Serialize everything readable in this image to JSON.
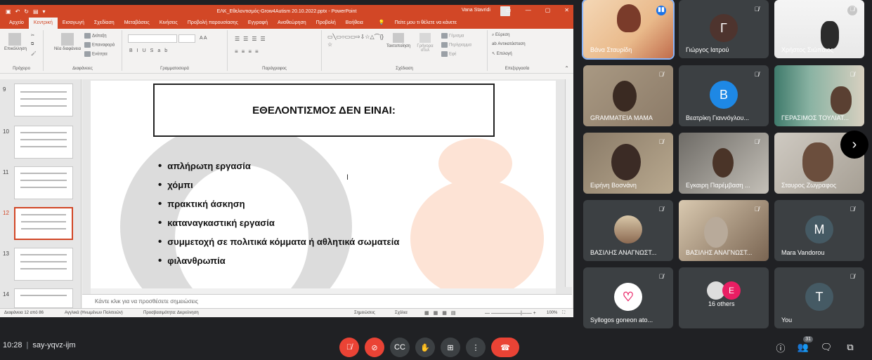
{
  "ppt": {
    "doc_title": "ΕΛΚ_Εθελοντισμός-Grow4Autism 20.10.2022.pptx - PowerPoint",
    "user": "Vana Stavridi",
    "tabs": [
      "Αρχείο",
      "Κεντρική",
      "Εισαγωγή",
      "Σχεδίαση",
      "Μεταβάσεις",
      "Κινήσεις",
      "Προβολή παρουσίασης",
      "Εγγραφή",
      "Αναθεώρηση",
      "Προβολή",
      "Βοήθεια"
    ],
    "tell_me": "Πείτε μου τι θέλετε να κάνετε",
    "ribbon": {
      "clipboard": "Πρόχειρο",
      "paste": "Επικόλληση",
      "new_slide": "Νέα διαφάνεια",
      "layout": "Διάταξη",
      "reset": "Επαναφορά",
      "section": "Ενότητα",
      "slides": "Διαφάνειες",
      "font": "Γραμματοσειρά",
      "paragraph": "Παράγραφος",
      "arrange": "Τακτοποίηση",
      "quick_styles": "Γρήγορα στυλ",
      "fill": "Γέμισμα",
      "outline": "Περίγραμμα",
      "effects": "Εφέ",
      "drawing": "Σχέδιαση",
      "find": "Εύρεση",
      "replace": "Αντικατάσταση",
      "select": "Επιλογή",
      "editing": "Επεξεργασία"
    },
    "thumbnails": [
      "9",
      "10",
      "11",
      "12",
      "13",
      "14"
    ],
    "slide": {
      "title": "ΕΘΕΛΟΝΤΙΣΜΟΣ ΔΕΝ ΕΙΝΑΙ:",
      "bullets": [
        "απλήρωτη εργασία",
        "χόμπι",
        "πρακτική άσκηση",
        "καταναγκαστική εργασία",
        "συμμετοχή σε πολιτικά κόμματα ή αθλητικά σωματεία",
        "φιλανθρωπία"
      ]
    },
    "notes_placeholder": "Κάντε κλικ για να προσθέσετε σημειώσεις",
    "status": {
      "slide_no": "Διαφάνεια 12 από 86",
      "language": "Αγγλικά (Ηνωμένων Πολιτειών)",
      "accessibility": "Προσβασιμότητα: Διερεύνηση",
      "notes": "Σημειώσεις",
      "comments": "Σχόλια",
      "zoom": "100%"
    }
  },
  "meet": {
    "participants": [
      {
        "name": "Βάνα Σταυρίδη",
        "type": "photo",
        "speaking": true
      },
      {
        "name": "Γιώργος Ιατρού",
        "type": "avatar",
        "initial": "Γ",
        "color": "#4e342e"
      },
      {
        "name": "Χρήστος Σιώπαιος",
        "type": "photo"
      },
      {
        "name": "GRAMMATEIA MAMA",
        "type": "photo"
      },
      {
        "name": "Βεατρίκη Γιαννόγλου...",
        "type": "avatar",
        "initial": "B",
        "color": "#1e88e5"
      },
      {
        "name": "ΓΕΡΑΣΙΜΟΣ ΤΟΥΛΙΑΤ...",
        "type": "photo"
      },
      {
        "name": "Ειρήνη Βοσνάνη",
        "type": "photo"
      },
      {
        "name": "Εγκαιρη Παρέμβαση ...",
        "type": "photo"
      },
      {
        "name": "Σταυρος Ζωγραφος",
        "type": "photo"
      },
      {
        "name": "ΒΑΣΙΛΗΣ ΑΝΑΓΝΩΣΤ...",
        "type": "avatar-photo"
      },
      {
        "name": "ΒΑΣΙΛΗΣ ΑΝΑΓΝΩΣΤ...",
        "type": "photo"
      },
      {
        "name": "Mara Vandorou",
        "type": "avatar",
        "initial": "M",
        "color": "#455a64"
      },
      {
        "name": "Syllogos goneon ato...",
        "type": "logo"
      },
      {
        "name": "16 others",
        "type": "others",
        "initial": "E",
        "color": "#e91e63"
      },
      {
        "name": "You",
        "type": "avatar",
        "initial": "T",
        "color": "#455a64"
      }
    ],
    "time": "10:28",
    "code": "say-yqvz-ijm",
    "people_count": "31"
  }
}
